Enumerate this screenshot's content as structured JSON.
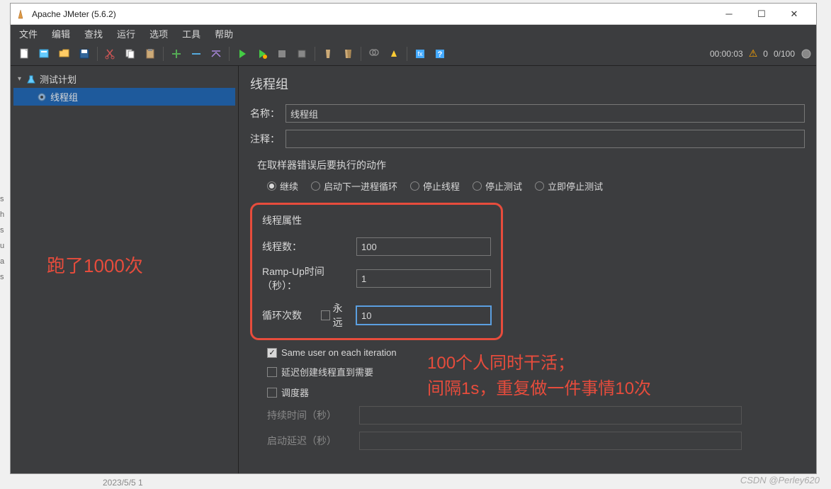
{
  "window": {
    "title": "Apache JMeter (5.6.2)"
  },
  "menu": [
    "文件",
    "编辑",
    "查找",
    "运行",
    "选项",
    "工具",
    "帮助"
  ],
  "toolbar_right": {
    "timer": "00:00:03",
    "error_count": "0",
    "thread_ratio": "0/100"
  },
  "tree": {
    "root": "测试计划",
    "child": "线程组"
  },
  "panel": {
    "title": "线程组",
    "name_label": "名称：",
    "name_value": "线程组",
    "comment_label": "注释：",
    "comment_value": "",
    "error_action_label": "在取样器错误后要执行的动作",
    "radio_options": [
      "继续",
      "启动下一进程循环",
      "停止线程",
      "停止测试",
      "立即停止测试"
    ],
    "radio_selected": 0,
    "thread_props": {
      "title": "线程属性",
      "threads_label": "线程数：",
      "threads_value": "100",
      "rampup_label": "Ramp-Up时间（秒）：",
      "rampup_value": "1",
      "loop_label": "循环次数",
      "forever_label": "永远",
      "loop_value": "10"
    },
    "checks": {
      "same_user": "Same user on each iteration",
      "delay_create": "延迟创建线程直到需要",
      "scheduler": "调度器"
    },
    "duration_label": "持续时间（秒）",
    "startup_delay_label": "启动延迟（秒）"
  },
  "annotations": {
    "left": "跑了1000次",
    "right_line1": "100个人同时干活；",
    "right_line2": "间隔1s，重复做一件事情10次"
  },
  "watermark": "CSDN @Perley620",
  "bottom_date": "2023/5/5 1"
}
